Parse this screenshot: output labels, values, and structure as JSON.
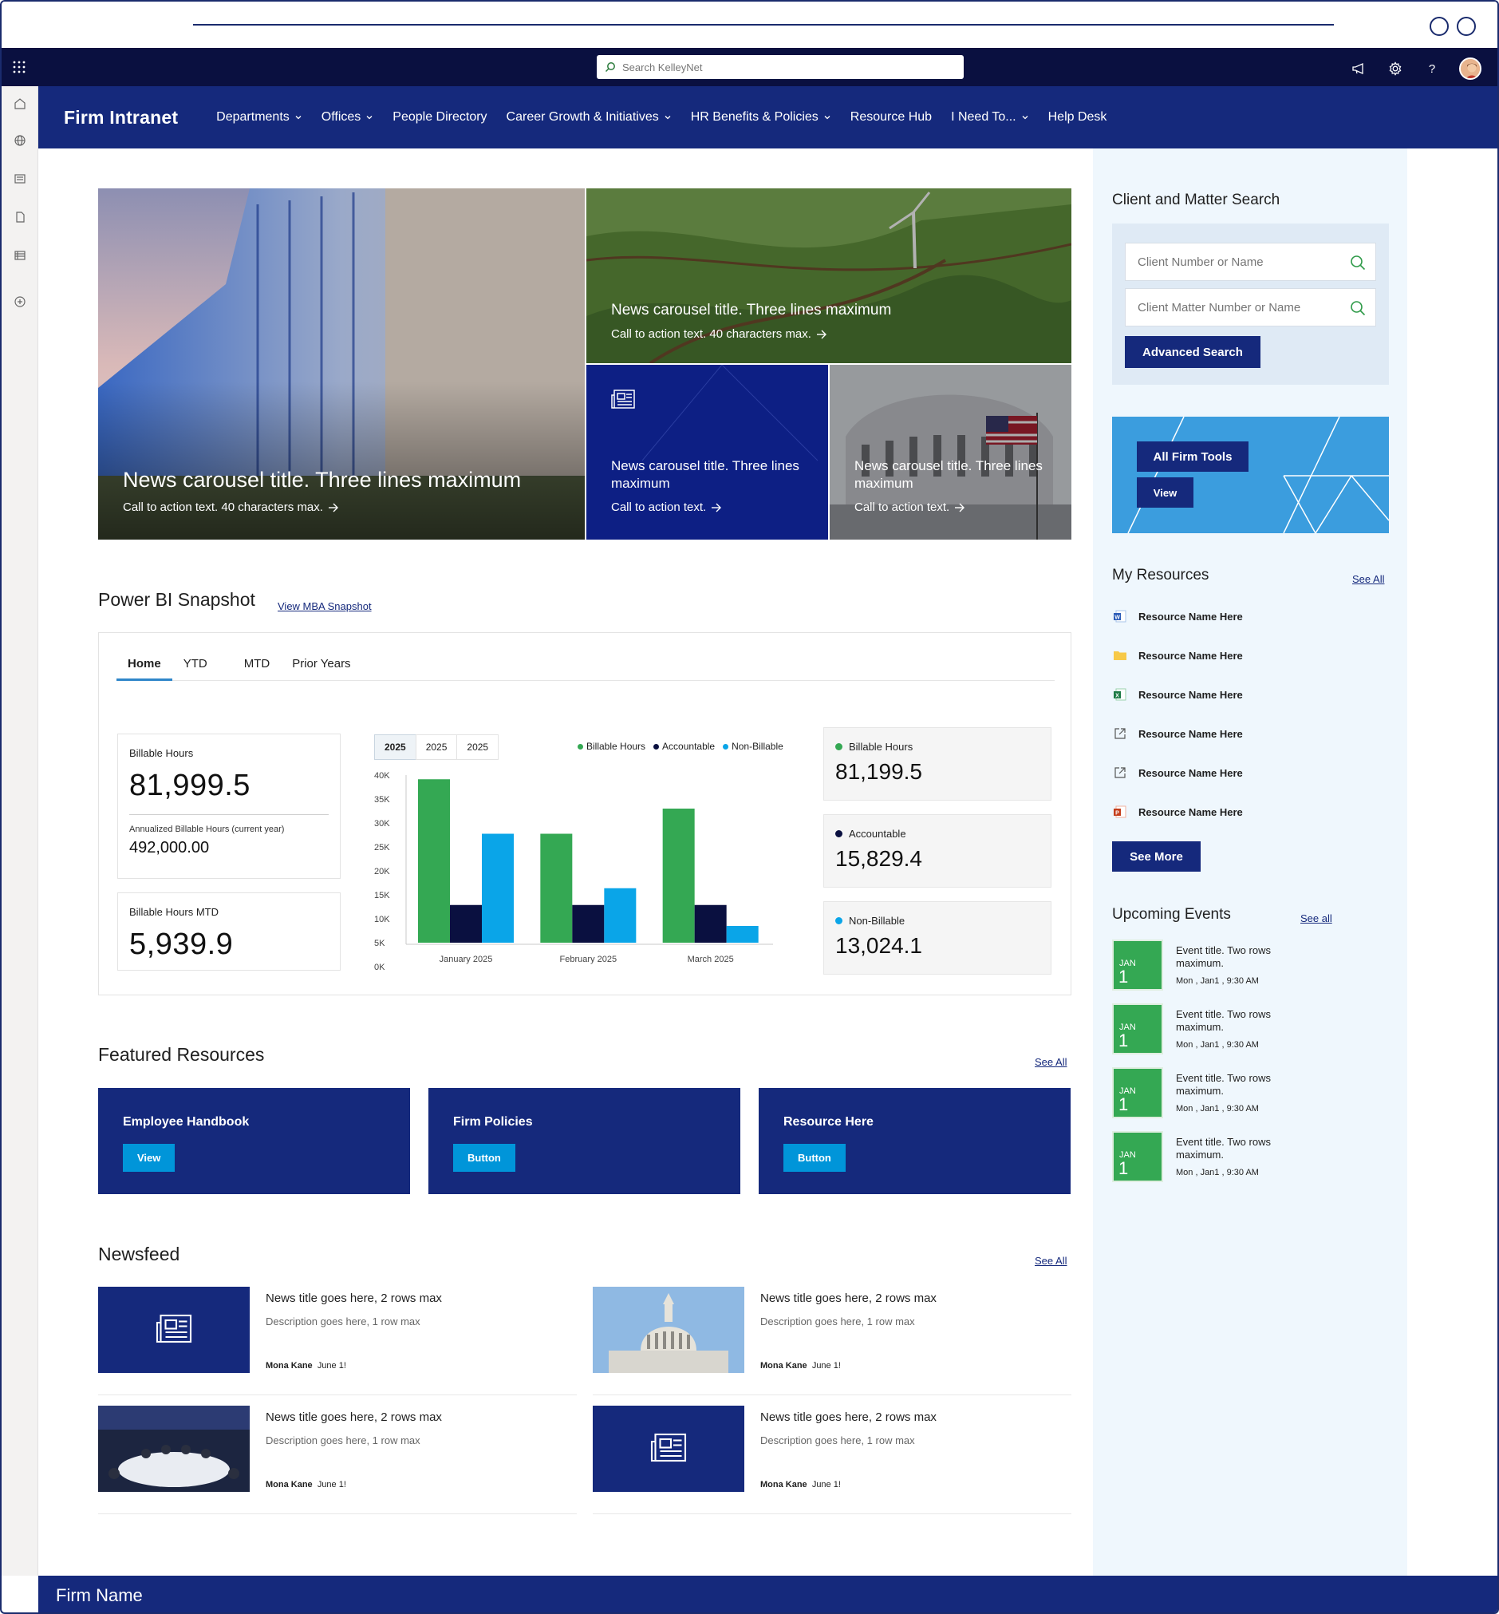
{
  "suite": {
    "search_placeholder": "Search KelleyNet"
  },
  "header": {
    "site_title": "Firm Intranet",
    "nav": [
      {
        "label": "Departments",
        "dropdown": true
      },
      {
        "label": "Offices",
        "dropdown": true
      },
      {
        "label": "People Directory",
        "dropdown": false
      },
      {
        "label": "Career Growth & Initiatives",
        "dropdown": true
      },
      {
        "label": "HR Benefits & Policies",
        "dropdown": true
      },
      {
        "label": "Resource Hub",
        "dropdown": false
      },
      {
        "label": "I Need To...",
        "dropdown": true
      },
      {
        "label": "Help Desk",
        "dropdown": false
      }
    ]
  },
  "hero": {
    "big": {
      "title": "News carousel title. Three lines maximum",
      "cta": "Call to action text. 40 characters max."
    },
    "top_right": {
      "title": "News carousel title. Three lines maximum",
      "cta": "Call to action text. 40 characters max."
    },
    "bottom_mid": {
      "title": "News carousel title. Three lines maximum",
      "cta": "Call to action text."
    },
    "bottom_right": {
      "title": "News carousel title. Three lines maximum",
      "cta": "Call to action text."
    }
  },
  "powerbi": {
    "title": "Power BI Snapshot",
    "link": "View MBA Snapshot",
    "tabs": [
      "Home",
      "YTD",
      "MTD",
      "Prior Years"
    ],
    "active_tab": "Home",
    "kpi1": {
      "label": "Billable Hours",
      "value": "81,999.5",
      "sub_label": "Annualized Billable Hours (current year)",
      "sub_value": "492,000.00"
    },
    "kpi2": {
      "label": "Billable Hours MTD",
      "value": "5,939.9"
    },
    "years": [
      "2025",
      "2025",
      "2025"
    ],
    "stats": [
      {
        "label": "Billable Hours",
        "value": "81,199.5",
        "color": "#34a853"
      },
      {
        "label": "Accountable",
        "value": "15,829.4",
        "color": "#0a1040"
      },
      {
        "label": "Non-Billable",
        "value": "13,024.1",
        "color": "#0aa5e8"
      }
    ]
  },
  "chart_data": {
    "type": "bar",
    "categories": [
      "January 2025",
      "February 2025",
      "March 2025"
    ],
    "series": [
      {
        "name": "Billable Hours",
        "values": [
          39000,
          26000,
          32000
        ],
        "color": "#34a853"
      },
      {
        "name": "Accountable",
        "values": [
          9000,
          9000,
          9000
        ],
        "color": "#0a1040"
      },
      {
        "name": "Non-Billable",
        "values": [
          26000,
          13000,
          4000
        ],
        "color": "#0aa5e8"
      }
    ],
    "yticks": [
      "40K",
      "35K",
      "30K",
      "25K",
      "20K",
      "15K",
      "10K",
      "5K",
      "0K"
    ],
    "ylim": [
      0,
      40000
    ]
  },
  "featured": {
    "title": "Featured Resources",
    "see_all": "See All",
    "cards": [
      {
        "title": "Employee Handbook",
        "button": "View"
      },
      {
        "title": "Firm Policies",
        "button": "Button"
      },
      {
        "title": "Resource Here",
        "button": "Button"
      }
    ]
  },
  "newsfeed": {
    "title": "Newsfeed",
    "see_all": "See All",
    "items": [
      {
        "title": "News title goes here, 2 rows max",
        "desc": "Description goes here, 1 row max",
        "author": "Mona Kane",
        "date": "June 1!"
      },
      {
        "title": "News title goes here, 2 rows max",
        "desc": "Description goes here, 1 row max",
        "author": "Mona Kane",
        "date": "June 1!"
      },
      {
        "title": "News title goes here, 2 rows max",
        "desc": "Description goes here, 1 row max",
        "author": "Mona Kane",
        "date": "June 1!"
      },
      {
        "title": "News title goes here, 2 rows max",
        "desc": "Description goes here, 1 row max",
        "author": "Mona Kane",
        "date": "June 1!"
      }
    ]
  },
  "side": {
    "cms": {
      "title": "Client and Matter Search",
      "client_placeholder": "Client Number or Name",
      "matter_placeholder": "Client Matter Number or Name",
      "advanced": "Advanced Search"
    },
    "tools": {
      "label": "All Firm Tools",
      "view": "View"
    },
    "resources": {
      "title": "My Resources",
      "see_all": "See All",
      "items": [
        {
          "label": "Resource Name Here",
          "icon": "word-icon"
        },
        {
          "label": "Resource Name Here",
          "icon": "folder-icon"
        },
        {
          "label": "Resource Name Here",
          "icon": "excel-icon"
        },
        {
          "label": "Resource Name Here",
          "icon": "external-link-icon"
        },
        {
          "label": "Resource Name Here",
          "icon": "external-link-icon"
        },
        {
          "label": "Resource Name Here",
          "icon": "powerpoint-icon"
        }
      ],
      "see_more": "See More"
    },
    "events": {
      "title": "Upcoming Events",
      "see_all": "See all",
      "items": [
        {
          "month": "JAN",
          "day": "1",
          "title": "Event title. Two rows maximum.",
          "time": "Mon , Jan1 , 9:30 AM"
        },
        {
          "month": "JAN",
          "day": "1",
          "title": "Event title. Two rows maximum.",
          "time": "Mon , Jan1 , 9:30 AM"
        },
        {
          "month": "JAN",
          "day": "1",
          "title": "Event title. Two rows maximum.",
          "time": "Mon , Jan1 , 9:30 AM"
        },
        {
          "month": "JAN",
          "day": "1",
          "title": "Event title. Two rows maximum.",
          "time": "Mon , Jan1 , 9:30 AM"
        }
      ]
    }
  },
  "footer": {
    "firm_name": "Firm Name"
  },
  "colors": {
    "brand": "#15297c",
    "suite": "#0a1040",
    "accent": "#0095d9",
    "event_green": "#34a853"
  }
}
